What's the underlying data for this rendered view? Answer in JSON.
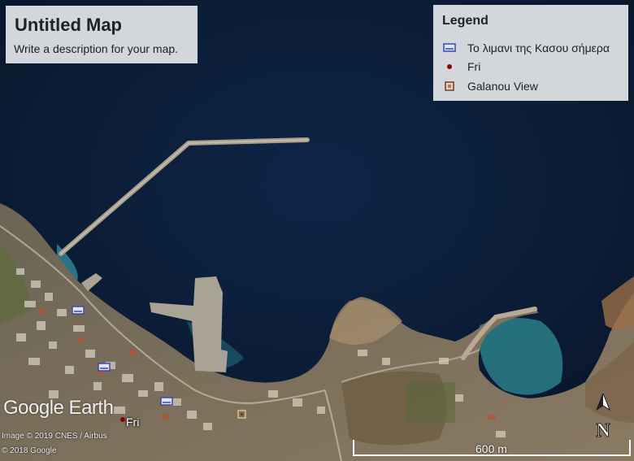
{
  "map": {
    "title": "Untitled Map",
    "description": "Write a description for your map."
  },
  "legend": {
    "title": "Legend",
    "items": [
      {
        "label": "Το λιμανι της Κασου σήμερα",
        "icon": "harbor-icon",
        "color": "#3b4aa8"
      },
      {
        "label": "Fri",
        "icon": "dot-marker-icon",
        "color": "#8b0000"
      },
      {
        "label": "Galanou View",
        "icon": "square-marker-icon",
        "color": "#7a3a10"
      }
    ]
  },
  "labels": {
    "place": "Fri",
    "logo": "Google Earth",
    "credit_imagery": "Image © 2019 CNES / Airbus",
    "credit_google": "© 2018 Google"
  },
  "scale": {
    "label": "600 m"
  },
  "compass": {
    "label": "N"
  }
}
